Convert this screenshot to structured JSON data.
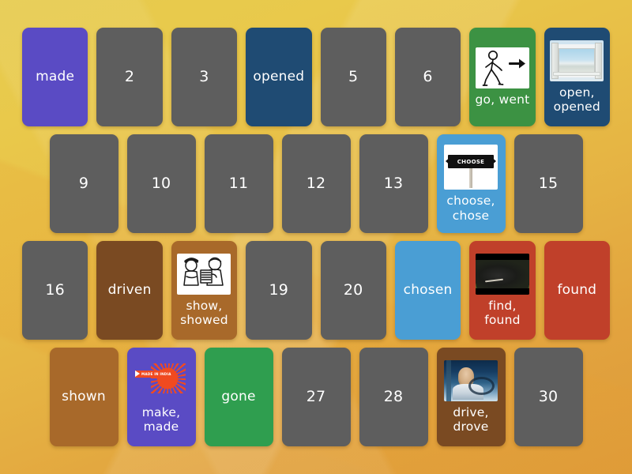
{
  "game": {
    "type": "matching-pairs-memory-board",
    "background_gradient_start": "#e6cb4e",
    "background_gradient_end": "#dd9a3a",
    "facedown_color": "#5e5e5e",
    "rows": 4,
    "total_cards": 30
  },
  "rows": [
    {
      "row_index": 1,
      "cards": [
        {
          "label": "made",
          "state": "faceup",
          "color": "#5a4bc4",
          "image": null
        },
        {
          "label": "2",
          "state": "facedown",
          "color": "#5e5e5e",
          "image": null
        },
        {
          "label": "3",
          "state": "facedown",
          "color": "#5e5e5e",
          "image": null
        },
        {
          "label": "opened",
          "state": "faceup",
          "color": "#1f4b73",
          "image": null
        },
        {
          "label": "5",
          "state": "facedown",
          "color": "#5e5e5e",
          "image": null
        },
        {
          "label": "6",
          "state": "facedown",
          "color": "#5e5e5e",
          "image": null
        },
        {
          "label": "go, went",
          "state": "faceup",
          "color": "#3c9243",
          "image": "walking-person-icon"
        },
        {
          "label": "open, opened",
          "state": "faceup",
          "color": "#1f4b73",
          "image": "open-window-beach-photo"
        }
      ]
    },
    {
      "row_index": 2,
      "cards": [
        {
          "label": "9",
          "state": "facedown",
          "color": "#5e5e5e",
          "image": null
        },
        {
          "label": "10",
          "state": "facedown",
          "color": "#5e5e5e",
          "image": null
        },
        {
          "label": "11",
          "state": "facedown",
          "color": "#5e5e5e",
          "image": null
        },
        {
          "label": "12",
          "state": "facedown",
          "color": "#5e5e5e",
          "image": null
        },
        {
          "label": "13",
          "state": "facedown",
          "color": "#5e5e5e",
          "image": null
        },
        {
          "label": "choose, chose",
          "state": "faceup",
          "color": "#4a9ed4",
          "image": "choose-road-sign"
        },
        {
          "label": "15",
          "state": "facedown",
          "color": "#5e5e5e",
          "image": null
        }
      ]
    },
    {
      "row_index": 3,
      "cards": [
        {
          "label": "16",
          "state": "facedown",
          "color": "#5e5e5e",
          "image": null
        },
        {
          "label": "driven",
          "state": "faceup",
          "color": "#7a4a22",
          "image": null
        },
        {
          "label": "show, showed",
          "state": "faceup",
          "color": "#a8692a",
          "image": "two-people-showing-picture-drawing"
        },
        {
          "label": "19",
          "state": "facedown",
          "color": "#5e5e5e",
          "image": null
        },
        {
          "label": "20",
          "state": "facedown",
          "color": "#5e5e5e",
          "image": null
        },
        {
          "label": "chosen",
          "state": "faceup",
          "color": "#4a9ed4",
          "image": null
        },
        {
          "label": "find, found",
          "state": "faceup",
          "color": "#c0402a",
          "image": "hands-searching-grass-photo"
        },
        {
          "label": "found",
          "state": "faceup",
          "color": "#c0402a",
          "image": null
        }
      ]
    },
    {
      "row_index": 4,
      "cards": [
        {
          "label": "shown",
          "state": "faceup",
          "color": "#a8692a",
          "image": null
        },
        {
          "label": "make, made",
          "state": "faceup",
          "color": "#5a4bc4",
          "image": "made-in-india-lion-logo"
        },
        {
          "label": "gone",
          "state": "faceup",
          "color": "#2f9e4f",
          "image": null
        },
        {
          "label": "27",
          "state": "facedown",
          "color": "#5e5e5e",
          "image": null
        },
        {
          "label": "28",
          "state": "facedown",
          "color": "#5e5e5e",
          "image": null
        },
        {
          "label": "drive, drove",
          "state": "faceup",
          "color": "#7a4a22",
          "image": "person-driving-car-photo"
        },
        {
          "label": "30",
          "state": "facedown",
          "color": "#5e5e5e",
          "image": null
        }
      ]
    }
  ],
  "images": {
    "choose_sign_text": "CHOOSE",
    "made_in_india_banner_text": "MADE IN INDIA"
  }
}
